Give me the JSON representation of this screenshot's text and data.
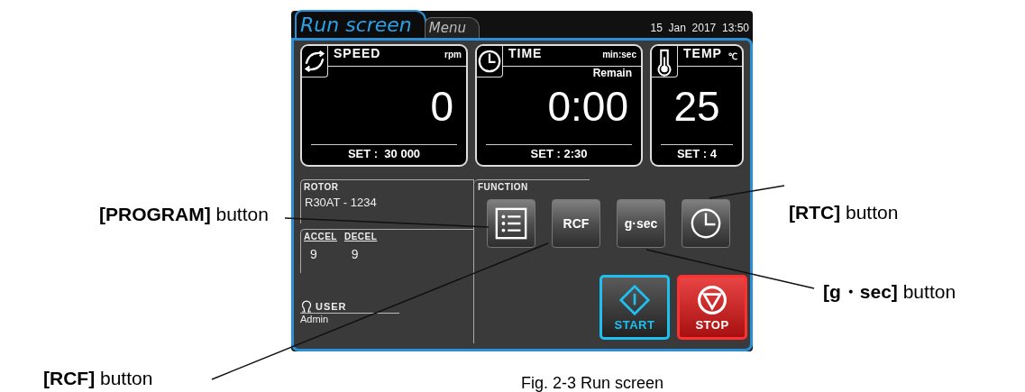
{
  "screen": {
    "tabs": [
      {
        "label": "Run screen",
        "selected": true
      },
      {
        "label": "Menu",
        "selected": false
      }
    ],
    "datetime": "15  Jan  2017  13:50",
    "panels": [
      {
        "kind": "speed",
        "title": "SPEED",
        "unit": "rpm",
        "value": "0",
        "set": "SET :  30 000"
      },
      {
        "kind": "time",
        "title": "TIME",
        "unit": "min:sec",
        "note": "Remain",
        "value": "0:00",
        "set": "SET : 2:30"
      },
      {
        "kind": "temp",
        "title": "TEMP",
        "unit": "℃",
        "value": "25",
        "set": "SET : 4"
      }
    ],
    "rotor": {
      "label": "ROTOR",
      "value": "R30AT - 1234"
    },
    "accel": {
      "label": "ACCEL",
      "value": "9"
    },
    "decel": {
      "label": "DECEL",
      "value": "9"
    },
    "function": {
      "label": "FUNCTION",
      "buttons": [
        {
          "kind": "program"
        },
        {
          "kind": "text",
          "label": "RCF"
        },
        {
          "kind": "text",
          "label": "g·sec"
        },
        {
          "kind": "clock"
        }
      ]
    },
    "start": {
      "label": "START"
    },
    "stop": {
      "label": "STOP"
    },
    "user": {
      "label": "USER",
      "value": "Admin"
    }
  },
  "callouts": [
    {
      "label": "**[PROGRAM]** button"
    },
    {
      "label": "**[RTC]** button"
    },
    {
      "label": "**[g・sec]** button"
    },
    {
      "label": "**[RCF]** button"
    }
  ],
  "caption": "Fig. 2-3 Run screen"
}
